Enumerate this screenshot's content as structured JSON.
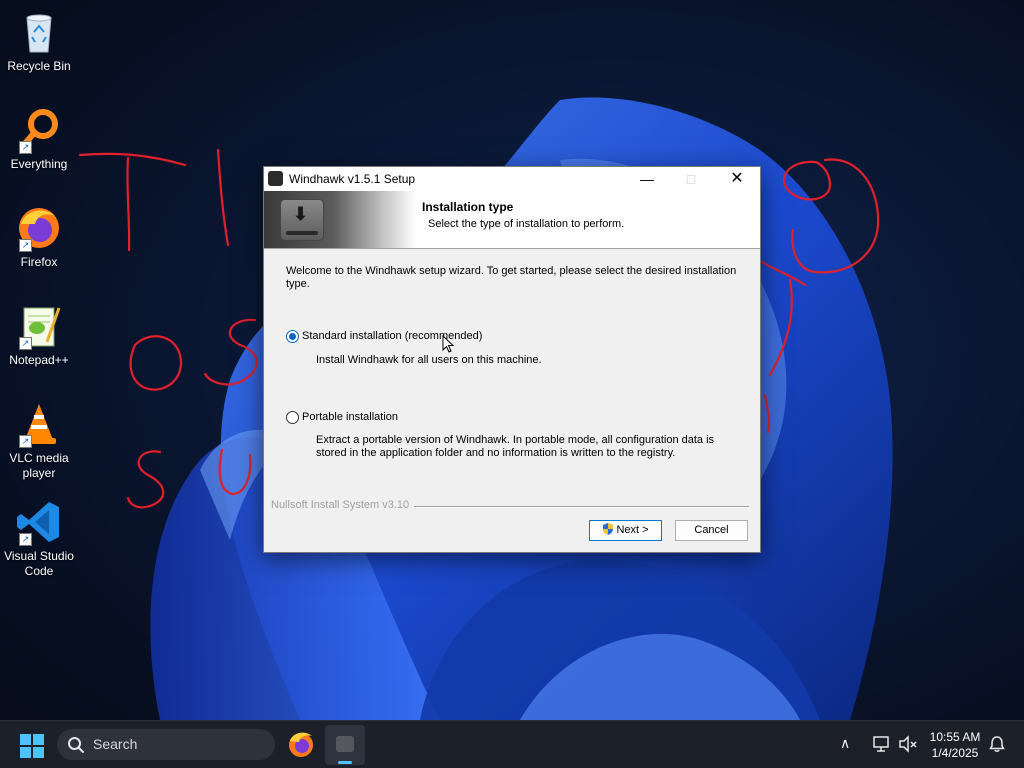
{
  "desktop": {
    "icons": [
      {
        "label": "Recycle Bin",
        "icon": "recycle-bin-icon"
      },
      {
        "label": "Everything",
        "icon": "everything-search-icon"
      },
      {
        "label": "Firefox",
        "icon": "firefox-icon"
      },
      {
        "label": "Notepad++",
        "icon": "notepad-plus-plus-icon"
      },
      {
        "label": "VLC media player",
        "icon": "vlc-icon"
      },
      {
        "label": "Visual Studio Code",
        "icon": "vscode-icon"
      }
    ]
  },
  "dialog": {
    "title": "Windhawk v1.5.1 Setup",
    "header_title": "Installation type",
    "header_subtitle": "Select the type of installation to perform.",
    "welcome": "Welcome to the Windhawk setup wizard. To get started, please select the desired installation type.",
    "options": [
      {
        "label": "Standard installation (recommended)",
        "description": "Install Windhawk for all users on this machine.",
        "selected": true
      },
      {
        "label": "Portable installation",
        "description": "Extract a portable version of Windhawk. In portable mode, all configuration data is stored in the application folder and no information is written to the registry.",
        "selected": false
      }
    ],
    "branding": "Nullsoft Install System v3.10",
    "next_label": "Next >",
    "cancel_label": "Cancel"
  },
  "taskbar": {
    "search_placeholder": "Search",
    "time": "10:55 AM",
    "date": "1/4/2025"
  },
  "colors": {
    "accent": "#0078d7",
    "taskbar": "#1c2029",
    "scribble": "#e0202a"
  }
}
